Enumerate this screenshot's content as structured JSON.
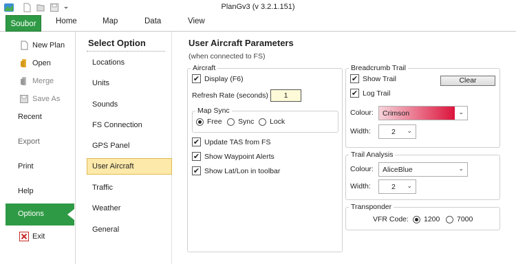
{
  "app": {
    "title": "PlanGv3 (v 3.2.1.151)"
  },
  "qat": {
    "icons": [
      "app-icon",
      "new-file-icon",
      "open-file-icon",
      "save-icon",
      "qat-dropdown-icon"
    ]
  },
  "ribbon": {
    "file_tab": "Soubor",
    "tabs": [
      "Home",
      "Map",
      "Data",
      "View"
    ]
  },
  "backstage": {
    "new_plan": "New Plan",
    "open": "Open",
    "merge": "Merge",
    "save_as": "Save As",
    "recent": "Recent",
    "export": "Export",
    "print": "Print",
    "help": "Help",
    "options": "Options",
    "exit": "Exit"
  },
  "options": {
    "heading": "Select Option",
    "items": [
      "Locations",
      "Units",
      "Sounds",
      "FS Connection",
      "GPS Panel",
      "User Aircraft",
      "Traffic",
      "Weather",
      "General"
    ],
    "active": "User Aircraft"
  },
  "main": {
    "title": "User Aircraft Parameters",
    "subtitle": "(when connected to FS)",
    "aircraft": {
      "legend": "Aircraft",
      "display_label": "Display (F6)",
      "display_checked": true,
      "refresh_label": "Refresh Rate (seconds)",
      "refresh_value": "1",
      "map_sync": {
        "legend": "Map Sync",
        "options": [
          "Free",
          "Sync",
          "Lock"
        ],
        "selected": "Free"
      },
      "update_tas_label": "Update TAS from FS",
      "update_tas_checked": true,
      "waypoint_alerts_label": "Show Waypoint Alerts",
      "waypoint_alerts_checked": true,
      "latlon_label": "Show Lat/Lon in toolbar",
      "latlon_checked": true
    },
    "breadcrumb": {
      "legend": "Breadcrumb Trail",
      "show_trail_label": "Show Trail",
      "show_trail_checked": true,
      "log_trail_label": "Log Trail",
      "log_trail_checked": true,
      "clear_label": "Clear",
      "colour_label": "Colour:",
      "colour_value": "Crimson",
      "colour_hex": "#dc143c",
      "width_label": "Width:",
      "width_value": "2"
    },
    "trail_analysis": {
      "legend": "Trail Analysis",
      "colour_label": "Colour:",
      "colour_value": "AliceBlue",
      "colour_hex": "#f0f8ff",
      "width_label": "Width:",
      "width_value": "2"
    },
    "transponder": {
      "legend": "Transponder",
      "vfr_label": "VFR Code:",
      "options": [
        "1200",
        "7000"
      ],
      "selected": "1200"
    }
  },
  "colors": {
    "accent_green": "#2f9a45",
    "active_option_bg": "#fde9a9"
  }
}
